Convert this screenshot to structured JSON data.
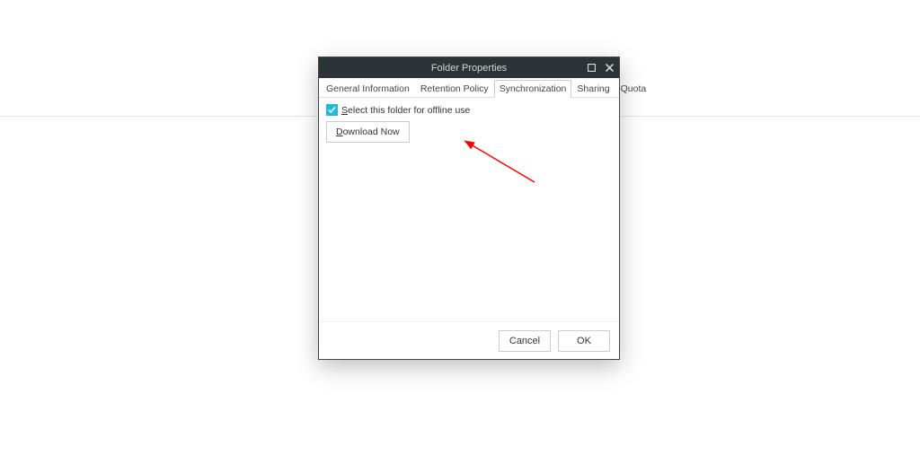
{
  "dialog": {
    "title": "Folder Properties"
  },
  "tabs": {
    "general": "General Information",
    "retention": "Retention Policy",
    "sync": "Synchronization",
    "sharing": "Sharing",
    "quota": "Quota"
  },
  "sync": {
    "checkbox_prefix": "S",
    "checkbox_rest": "elect this folder for offline use",
    "download_prefix": "D",
    "download_rest": "ownload Now"
  },
  "footer": {
    "cancel": "Cancel",
    "ok": "OK"
  }
}
